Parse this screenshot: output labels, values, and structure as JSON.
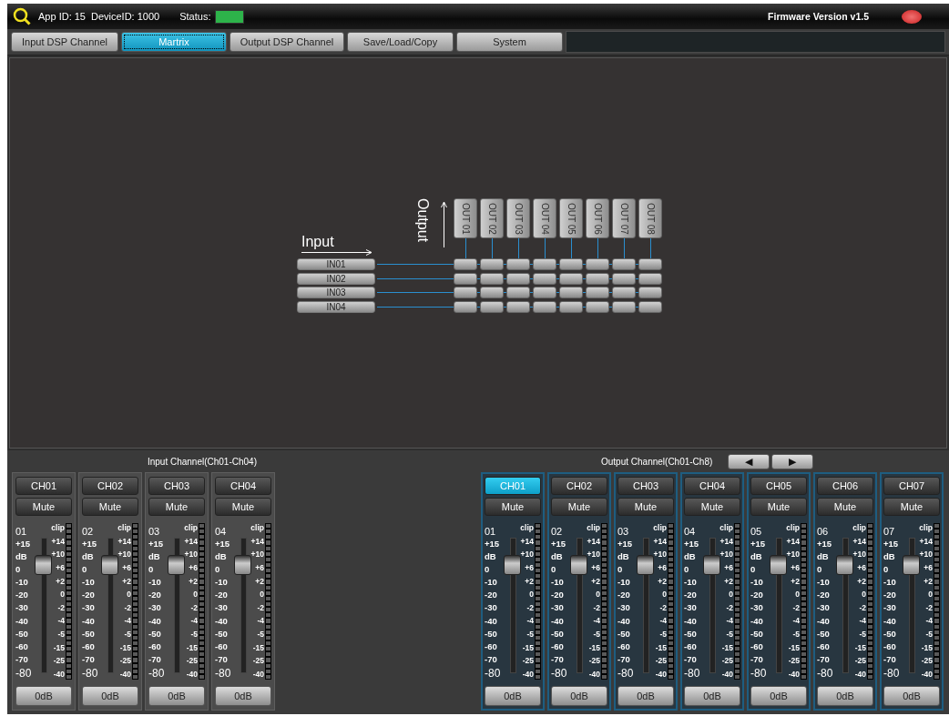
{
  "header": {
    "app_id": "App ID: 15",
    "device_id": "DeviceID: 1000",
    "status_label": "Status:",
    "status_ok": true,
    "firmware": "Firmware Version v1.5"
  },
  "tabs": [
    {
      "label": "Input DSP Channel",
      "selected": false
    },
    {
      "label": "Martrix",
      "selected": true
    },
    {
      "label": "Output DSP Channel",
      "selected": false
    },
    {
      "label": "Save/Load/Copy",
      "selected": false
    },
    {
      "label": "System",
      "selected": false
    }
  ],
  "matrix": {
    "input_label": "Input",
    "output_label": "Output",
    "outputs": [
      "OUT 01",
      "OUT 02",
      "OUT 03",
      "OUT 04",
      "OUT 05",
      "OUT 06",
      "OUT 07",
      "OUT 08"
    ],
    "inputs": [
      {
        "label": "IN01",
        "routes": [
          false,
          false,
          false,
          false,
          false,
          false,
          false,
          false
        ]
      },
      {
        "label": "IN02",
        "routes": [
          false,
          false,
          false,
          false,
          false,
          false,
          false,
          false
        ]
      },
      {
        "label": "IN03",
        "routes": [
          false,
          false,
          false,
          false,
          false,
          false,
          false,
          false
        ]
      },
      {
        "label": "IN04",
        "routes": [
          false,
          false,
          false,
          false,
          false,
          false,
          false,
          false
        ]
      }
    ]
  },
  "input_panel": {
    "title": "Input Channel(Ch01-Ch04)",
    "channels": [
      {
        "name": "CH01",
        "selected": false,
        "mute": "Mute",
        "muted": false,
        "number": "01",
        "level": 0.86,
        "left_scale": [
          "+15",
          "dB",
          "0",
          "-10",
          "-20",
          "-30",
          "-40",
          "-50",
          "-60",
          "-70",
          "-80"
        ],
        "right_scale": [
          "clip",
          "+14",
          "+10",
          "+6",
          "+2",
          "0",
          "-2",
          "-4",
          "-5",
          "-15",
          "-25",
          "-40"
        ],
        "gain": "0dB"
      },
      {
        "name": "CH02",
        "selected": false,
        "mute": "Mute",
        "muted": false,
        "number": "02",
        "level": 0.86,
        "left_scale": [
          "+15",
          "dB",
          "0",
          "-10",
          "-20",
          "-30",
          "-40",
          "-50",
          "-60",
          "-70",
          "-80"
        ],
        "right_scale": [
          "clip",
          "+14",
          "+10",
          "+6",
          "+2",
          "0",
          "-2",
          "-4",
          "-5",
          "-15",
          "-25",
          "-40"
        ],
        "gain": "0dB"
      },
      {
        "name": "CH03",
        "selected": false,
        "mute": "Mute",
        "muted": false,
        "number": "03",
        "level": 0.86,
        "left_scale": [
          "+15",
          "dB",
          "0",
          "-10",
          "-20",
          "-30",
          "-40",
          "-50",
          "-60",
          "-70",
          "-80"
        ],
        "right_scale": [
          "clip",
          "+14",
          "+10",
          "+6",
          "+2",
          "0",
          "-2",
          "-4",
          "-5",
          "-15",
          "-25",
          "-40"
        ],
        "gain": "0dB"
      },
      {
        "name": "CH04",
        "selected": false,
        "mute": "Mute",
        "muted": false,
        "number": "04",
        "level": 0.86,
        "left_scale": [
          "+15",
          "dB",
          "0",
          "-10",
          "-20",
          "-30",
          "-40",
          "-50",
          "-60",
          "-70",
          "-80"
        ],
        "right_scale": [
          "clip",
          "+14",
          "+10",
          "+6",
          "+2",
          "0",
          "-2",
          "-4",
          "-5",
          "-15",
          "-25",
          "-40"
        ],
        "gain": "0dB"
      }
    ]
  },
  "output_panel": {
    "title": "Output Channel(Ch01-Ch8)",
    "nav": [
      "◀",
      "▶"
    ],
    "channels": [
      {
        "name": "CH01",
        "selected": true,
        "mute": "Mute",
        "muted": false,
        "number": "01",
        "level": 0.86,
        "left_scale": [
          "+15",
          "dB",
          "0",
          "-10",
          "-20",
          "-30",
          "-40",
          "-50",
          "-60",
          "-70",
          "-80"
        ],
        "right_scale": [
          "clip",
          "+14",
          "+10",
          "+6",
          "+2",
          "0",
          "-2",
          "-4",
          "-5",
          "-15",
          "-25",
          "-40"
        ],
        "gain": "0dB"
      },
      {
        "name": "CH02",
        "selected": false,
        "mute": "Mute",
        "muted": false,
        "number": "02",
        "level": 0.86,
        "left_scale": [
          "+15",
          "dB",
          "0",
          "-10",
          "-20",
          "-30",
          "-40",
          "-50",
          "-60",
          "-70",
          "-80"
        ],
        "right_scale": [
          "clip",
          "+14",
          "+10",
          "+6",
          "+2",
          "0",
          "-2",
          "-4",
          "-5",
          "-15",
          "-25",
          "-40"
        ],
        "gain": "0dB"
      },
      {
        "name": "CH03",
        "selected": false,
        "mute": "Mute",
        "muted": false,
        "number": "03",
        "level": 0.86,
        "left_scale": [
          "+15",
          "dB",
          "0",
          "-10",
          "-20",
          "-30",
          "-40",
          "-50",
          "-60",
          "-70",
          "-80"
        ],
        "right_scale": [
          "clip",
          "+14",
          "+10",
          "+6",
          "+2",
          "0",
          "-2",
          "-4",
          "-5",
          "-15",
          "-25",
          "-40"
        ],
        "gain": "0dB"
      },
      {
        "name": "CH04",
        "selected": false,
        "mute": "Mute",
        "muted": false,
        "number": "04",
        "level": 0.86,
        "left_scale": [
          "+15",
          "dB",
          "0",
          "-10",
          "-20",
          "-30",
          "-40",
          "-50",
          "-60",
          "-70",
          "-80"
        ],
        "right_scale": [
          "clip",
          "+14",
          "+10",
          "+6",
          "+2",
          "0",
          "-2",
          "-4",
          "-5",
          "-15",
          "-25",
          "-40"
        ],
        "gain": "0dB"
      },
      {
        "name": "CH05",
        "selected": false,
        "mute": "Mute",
        "muted": false,
        "number": "05",
        "level": 0.86,
        "left_scale": [
          "+15",
          "dB",
          "0",
          "-10",
          "-20",
          "-30",
          "-40",
          "-50",
          "-60",
          "-70",
          "-80"
        ],
        "right_scale": [
          "clip",
          "+14",
          "+10",
          "+6",
          "+2",
          "0",
          "-2",
          "-4",
          "-5",
          "-15",
          "-25",
          "-40"
        ],
        "gain": "0dB"
      },
      {
        "name": "CH06",
        "selected": false,
        "mute": "Mute",
        "muted": false,
        "number": "06",
        "level": 0.86,
        "left_scale": [
          "+15",
          "dB",
          "0",
          "-10",
          "-20",
          "-30",
          "-40",
          "-50",
          "-60",
          "-70",
          "-80"
        ],
        "right_scale": [
          "clip",
          "+14",
          "+10",
          "+6",
          "+2",
          "0",
          "-2",
          "-4",
          "-5",
          "-15",
          "-25",
          "-40"
        ],
        "gain": "0dB"
      },
      {
        "name": "CH07",
        "selected": false,
        "mute": "Mute",
        "muted": false,
        "number": "07",
        "level": 0.86,
        "left_scale": [
          "+15",
          "dB",
          "0",
          "-10",
          "-20",
          "-30",
          "-40",
          "-50",
          "-60",
          "-70",
          "-80"
        ],
        "right_scale": [
          "clip",
          "+14",
          "+10",
          "+6",
          "+2",
          "0",
          "-2",
          "-4",
          "-5",
          "-15",
          "-25",
          "-40"
        ],
        "gain": "0dB"
      }
    ]
  }
}
